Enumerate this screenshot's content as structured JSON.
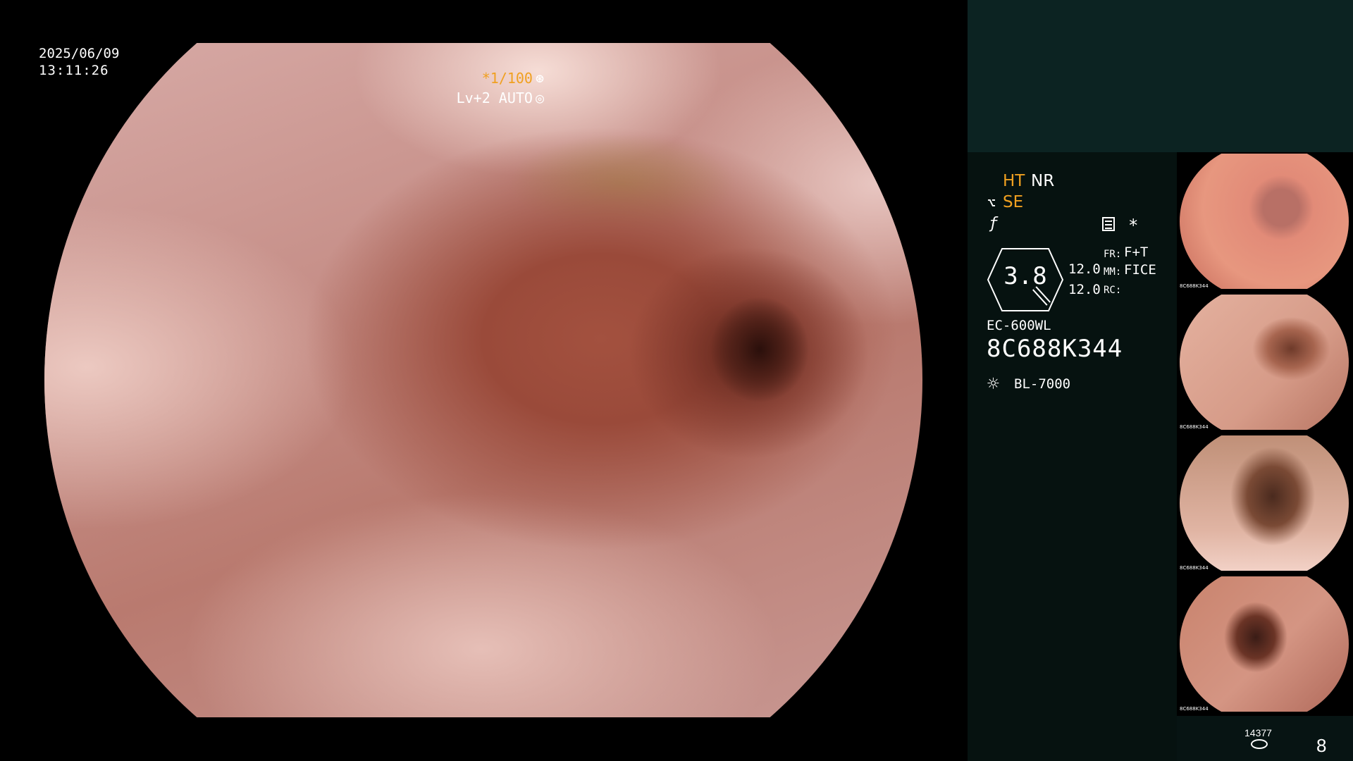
{
  "main": {
    "date": "2025/06/09",
    "time": "13:11:26",
    "shutter": "*1/100",
    "shutter_icon": "⊛",
    "iris": "Lv+2 AUTO",
    "iris_icon": "◎"
  },
  "panel": {
    "ht": "HT",
    "nr": "NR",
    "se": "SE",
    "dial_value": "3.8",
    "val1": "12.0",
    "val2": "12.0",
    "fr_label": "FR:",
    "fr_value": "F+T",
    "mm_label": "MM:",
    "mm_value": "FICE",
    "rc_label": "RC:",
    "model": "EC-600WL",
    "serial": "8C688K344",
    "light_source": "BL-7000"
  },
  "thumbnails": [
    {
      "caption": "8C688K344"
    },
    {
      "caption": "8C688K344"
    },
    {
      "caption": "8C688K344"
    },
    {
      "caption": "8C688K344"
    }
  ],
  "footer": {
    "counter": "14377",
    "count": "8"
  },
  "colors": {
    "accent": "#f0a020",
    "panel_bg": "#071413",
    "top_box": "#0c2322"
  }
}
